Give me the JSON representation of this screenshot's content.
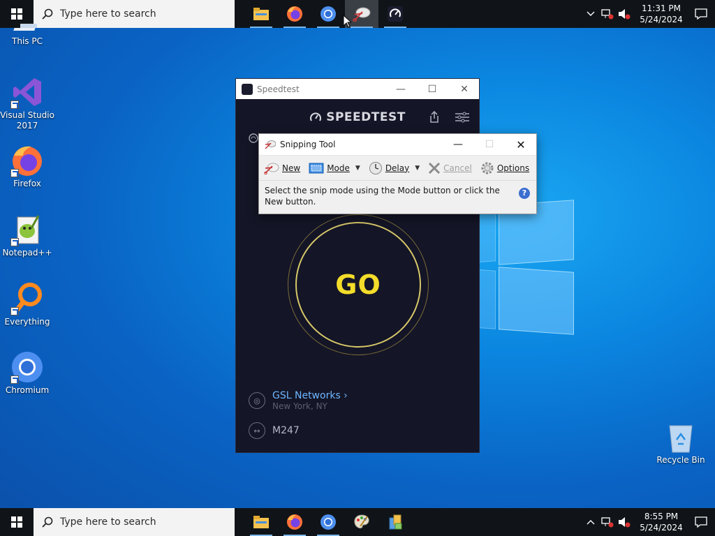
{
  "taskbar_top": {
    "search_placeholder": "Type here to search",
    "time": "11:31 PM",
    "date": "5/24/2024",
    "apps": [
      "file-explorer",
      "firefox",
      "chromium",
      "snipping-tool",
      "speedtest"
    ]
  },
  "taskbar_bottom": {
    "search_placeholder": "Type here to search",
    "time": "8:55 PM",
    "date": "5/24/2024",
    "apps": [
      "file-explorer",
      "firefox",
      "chromium",
      "snipping-tool",
      "kiosk-app"
    ]
  },
  "desktop": {
    "icons": [
      {
        "label": "This PC"
      },
      {
        "label": "Visual Studio 2017"
      },
      {
        "label": "Firefox"
      },
      {
        "label": "Notepad++"
      },
      {
        "label": "Everything"
      },
      {
        "label": "Chromium"
      },
      {
        "label": "Recycle Bin"
      }
    ]
  },
  "speedtest": {
    "window_title": "Speedtest",
    "logo_text": "SPEEDTEST",
    "go_label": "GO",
    "isp_name": "GSL Networks",
    "isp_location": "New York, NY",
    "host_name": "M247",
    "accent_color": "#f4dd2a"
  },
  "snipping_tool": {
    "window_title": "Snipping Tool",
    "toolbar": {
      "new_label": "New",
      "mode_label": "Mode",
      "delay_label": "Delay",
      "cancel_label": "Cancel",
      "options_label": "Options"
    },
    "message": "Select the snip mode using the Mode button or click the New button.",
    "help_label": "?"
  }
}
